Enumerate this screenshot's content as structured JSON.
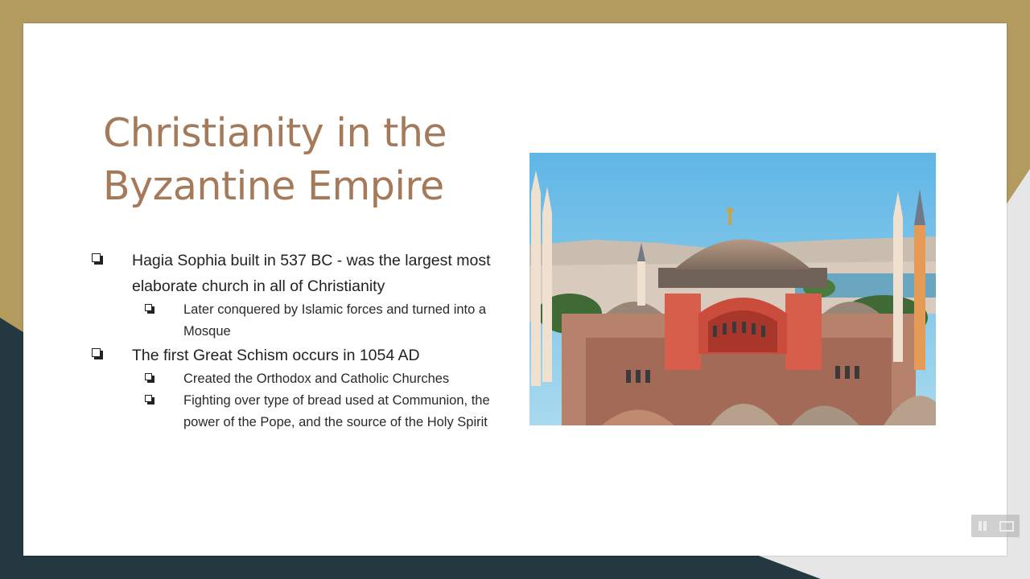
{
  "slide": {
    "title_line1": "Christianity in the",
    "title_line2": "Byzantine Empire",
    "bullets": [
      {
        "text": "Hagia Sophia built in 537 BC - was the largest most elaborate church in all of Christianity"
      },
      {
        "text": "Later conquered by Islamic forces and turned into a Mosque"
      },
      {
        "text": "The first Great Schism occurs in 1054 AD"
      },
      {
        "text": "Created the Orthodox and Catholic Churches"
      },
      {
        "text": "Fighting over type of bread used at Communion, the power of the Pope, and the source of the Holy Spirit"
      }
    ],
    "image_subject": "Hagia Sophia photograph"
  },
  "player": {
    "pause_icon": "pause-icon",
    "screen_icon": "screen-icon"
  },
  "colors": {
    "gold": "#b39a5e",
    "dark_teal": "#243840",
    "light_gray": "#e6e6e6",
    "title_brown": "#a47a5a"
  }
}
